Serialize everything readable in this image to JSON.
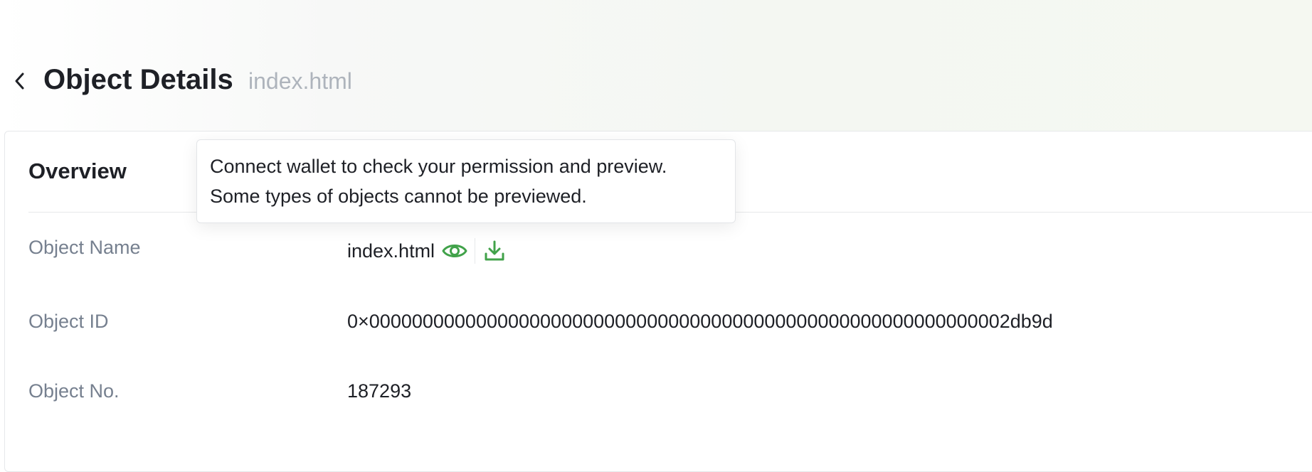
{
  "header": {
    "title": "Object Details",
    "subtitle": "index.html"
  },
  "overview": {
    "title": "Overview",
    "rows": [
      {
        "label": "Object Name",
        "value": "index.html"
      },
      {
        "label": "Object ID",
        "value": "0×000000000000000000000000000000000000000000000000000000000002db9d"
      },
      {
        "label": "Object No.",
        "value": "187293"
      }
    ]
  },
  "tooltip": {
    "line1": "Connect wallet to check your permission and preview.",
    "line2": "Some types of objects cannot be previewed."
  },
  "icons": {
    "back": "chevron-left-icon",
    "preview": "eye-icon",
    "download": "download-icon"
  },
  "colors": {
    "accent": "#41a24a",
    "label": "#76808f",
    "subtitle": "#aeb4bc",
    "text": "#1e2026"
  }
}
